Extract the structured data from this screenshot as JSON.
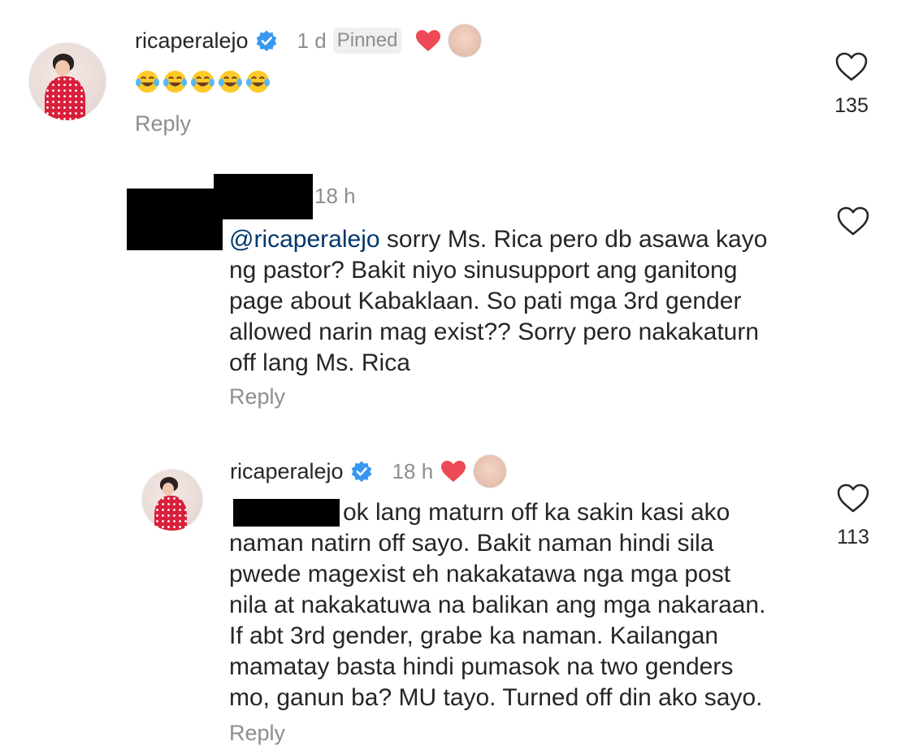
{
  "comments": [
    {
      "username": "ricaperalejo",
      "time": "1 d",
      "pinned_label": "Pinned",
      "text": "😂😂😂😂😂",
      "emoji_count": 5,
      "reply_label": "Reply",
      "likes": "135"
    },
    {
      "username": "",
      "time": "18 h",
      "mention": "@ricaperalejo",
      "text_lines": [
        " sorry Ms. Rica pero db asawa kayo",
        "ng pastor? Bakit niyo sinusupport ang ganitong",
        "page about Kabaklaan. So pati mga 3rd gender",
        "allowed narin mag exist?? Sorry pero nakakaturn",
        "off lang Ms. Rica"
      ],
      "reply_label": "Reply"
    },
    {
      "username": "ricaperalejo",
      "time": "18 h",
      "text_lines": [
        "ok lang maturn off ka sakin kasi ako",
        "naman natirn off sayo. Bakit naman hindi sila",
        "pwede magexist eh nakakatawa nga mga post",
        "nila at nakakatuwa na balikan ang mga nakaraan.",
        "If abt 3rd gender, grabe ka naman. Kailangan",
        "mamatay basta hindi pumasok na two genders",
        "mo, ganun ba? MU tayo. Turned off din ako sayo."
      ],
      "reply_label": "Reply",
      "likes": "113"
    }
  ],
  "icons": {
    "verified": "verified-badge-icon",
    "heart_filled": "heart-filled-icon",
    "heart_outline": "heart-outline-icon",
    "laughing_emoji": "laughing-crying-emoji-icon"
  },
  "colors": {
    "verified_blue": "#3897f0",
    "heart_red": "#ed4956",
    "mention_blue": "#00376b",
    "meta_gray": "#8e8e8e"
  }
}
